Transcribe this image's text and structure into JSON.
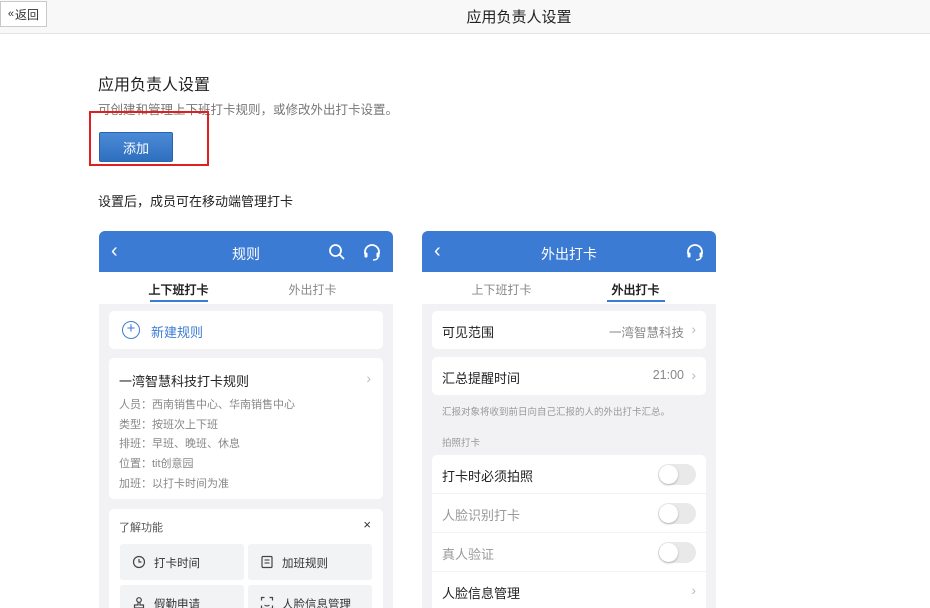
{
  "topbar": {
    "back_label": "返回",
    "title": "应用负责人设置"
  },
  "section": {
    "title": "应用负责人设置",
    "description": "可创建和管理上下班打卡规则，或修改外出打卡设置。",
    "add_label": "添加",
    "mobile_hint": "设置后，成员可在移动端管理打卡"
  },
  "phone_rules": {
    "title": "规则",
    "tabs": [
      "上下班打卡",
      "外出打卡"
    ],
    "active_tab": 0,
    "new_rule_label": "新建规则",
    "rule": {
      "name": "一湾智慧科技打卡规则",
      "details": [
        "人员：西南销售中心、华南销售中心",
        "类型：按班次上下班",
        "排班：早班、晚班、休息",
        "位置：tit创意园",
        "加班：以打卡时间为准"
      ]
    },
    "features": {
      "title": "了解功能",
      "close": "×",
      "items": [
        {
          "label": "打卡时间",
          "icon": "clock-icon"
        },
        {
          "label": "加班规则",
          "icon": "document-icon"
        },
        {
          "label": "假勤申请",
          "icon": "stamp-icon"
        },
        {
          "label": "人脸信息管理",
          "icon": "face-scan-icon"
        }
      ]
    }
  },
  "phone_outing": {
    "title": "外出打卡",
    "tabs": [
      "上下班打卡",
      "外出打卡"
    ],
    "active_tab": 1,
    "visible_range": {
      "label": "可见范围",
      "value": "一湾智慧科技"
    },
    "summary_time": {
      "label": "汇总提醒时间",
      "value": "21:00"
    },
    "summary_note": "汇报对象将收到前日向自己汇报的人的外出打卡汇总。",
    "photo_section": "拍照打卡",
    "toggles": [
      {
        "label": "打卡时必须拍照",
        "muted": false,
        "on": false
      },
      {
        "label": "人脸识别打卡",
        "muted": true,
        "on": false
      },
      {
        "label": "真人验证",
        "muted": true,
        "on": false
      }
    ],
    "face_manage": "人脸信息管理"
  },
  "colors": {
    "accent": "#3b7bd4",
    "highlight": "#e02020",
    "button": "#2f6fbf"
  }
}
